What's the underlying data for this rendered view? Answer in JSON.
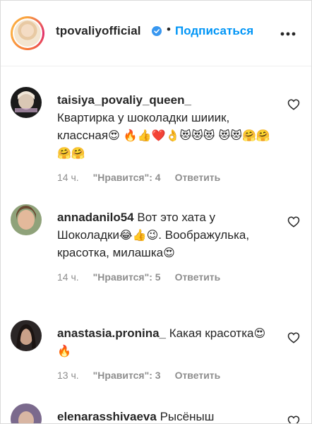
{
  "header": {
    "username": "tpovaliyofficial",
    "separator": "•",
    "follow_label": "Подписаться"
  },
  "comments": [
    {
      "username": "taisiya_povaliy_queen_",
      "text": "Квартирка у шоколадки шииик, классная",
      "emoji": "😍 🔥👍❤️👌😻😻😻 😻😻🤗🤗🤗🤗",
      "time": "14 ч.",
      "likes": "\"Нравится\": 4",
      "reply_label": "Ответить"
    },
    {
      "username": "annadanilo54",
      "text": "Вот это хата у Шоколадки",
      "emoji": "😂👍😉",
      "text2": ". Воображулька, красотка, милашка",
      "emoji2": "😍",
      "time": "14 ч.",
      "likes": "\"Нравится\": 5",
      "reply_label": "Ответить"
    },
    {
      "username": "anastasia.pronina_",
      "text": "Какая красотка",
      "emoji": "😍 🔥",
      "time": "13 ч.",
      "likes": "\"Нравится\": 3",
      "reply_label": "Ответить"
    },
    {
      "username": "elenarasshivaeva",
      "text": "Рысёныш"
    }
  ]
}
